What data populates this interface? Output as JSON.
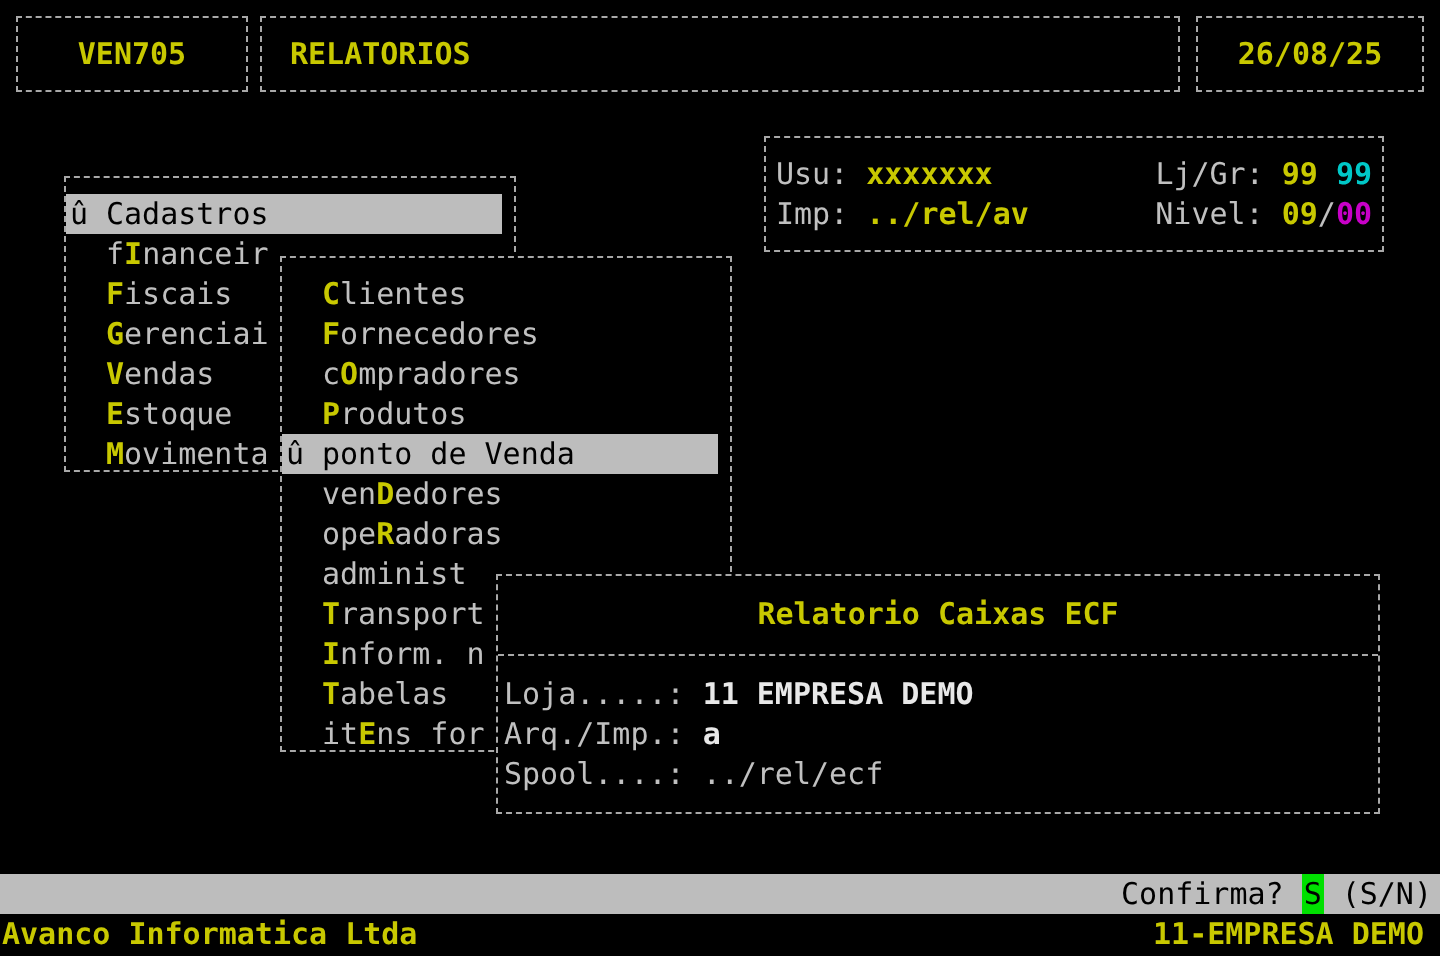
{
  "header": {
    "program": "VEN705",
    "title": "RELATORIOS",
    "date": "26/08/25"
  },
  "session": {
    "user_label": "Usu:",
    "user": "xxxxxxx",
    "printer_label": "Imp:",
    "printer": "../rel/av",
    "store_label": "Lj/Gr:",
    "store": "99",
    "group": "99",
    "level_label": "Nivel:",
    "level_code": "09",
    "level_separator": "/",
    "level_sub": "00"
  },
  "main_menu": {
    "items": [
      {
        "selected": true,
        "marker": "û",
        "segments": [
          {
            "text": "Cadastros",
            "hot": false
          }
        ]
      },
      {
        "selected": false,
        "segments": [
          {
            "text": "f",
            "hot": false
          },
          {
            "text": "I",
            "hot": true
          },
          {
            "text": "nanceir",
            "hot": false
          }
        ]
      },
      {
        "selected": false,
        "segments": [
          {
            "text": "F",
            "hot": true
          },
          {
            "text": "iscais",
            "hot": false
          }
        ]
      },
      {
        "selected": false,
        "segments": [
          {
            "text": "G",
            "hot": true
          },
          {
            "text": "erenciai",
            "hot": false
          }
        ]
      },
      {
        "selected": false,
        "segments": [
          {
            "text": "V",
            "hot": true
          },
          {
            "text": "endas",
            "hot": false
          }
        ]
      },
      {
        "selected": false,
        "segments": [
          {
            "text": "E",
            "hot": true
          },
          {
            "text": "stoque",
            "hot": false
          }
        ]
      },
      {
        "selected": false,
        "segments": [
          {
            "text": "M",
            "hot": true
          },
          {
            "text": "ovimenta",
            "hot": false
          }
        ]
      }
    ]
  },
  "submenu": {
    "items": [
      {
        "selected": false,
        "segments": [
          {
            "text": "C",
            "hot": true
          },
          {
            "text": "lientes",
            "hot": false
          }
        ]
      },
      {
        "selected": false,
        "segments": [
          {
            "text": "F",
            "hot": true
          },
          {
            "text": "ornecedores",
            "hot": false
          }
        ]
      },
      {
        "selected": false,
        "segments": [
          {
            "text": "c",
            "hot": false
          },
          {
            "text": "O",
            "hot": true
          },
          {
            "text": "mpradores",
            "hot": false
          }
        ]
      },
      {
        "selected": false,
        "segments": [
          {
            "text": "P",
            "hot": true
          },
          {
            "text": "rodutos",
            "hot": false
          }
        ]
      },
      {
        "selected": true,
        "marker": "û",
        "segments": [
          {
            "text": "ponto de Venda",
            "hot": false
          }
        ]
      },
      {
        "selected": false,
        "segments": [
          {
            "text": "ven",
            "hot": false
          },
          {
            "text": "D",
            "hot": true
          },
          {
            "text": "edores",
            "hot": false
          }
        ]
      },
      {
        "selected": false,
        "segments": [
          {
            "text": "ope",
            "hot": false
          },
          {
            "text": "R",
            "hot": true
          },
          {
            "text": "adoras",
            "hot": false
          }
        ]
      },
      {
        "selected": false,
        "segments": [
          {
            "text": "administ",
            "hot": false
          }
        ]
      },
      {
        "selected": false,
        "segments": [
          {
            "text": "T",
            "hot": true
          },
          {
            "text": "ransport",
            "hot": false
          }
        ]
      },
      {
        "selected": false,
        "segments": [
          {
            "text": "I",
            "hot": true
          },
          {
            "text": "nform. n",
            "hot": false
          }
        ]
      },
      {
        "selected": false,
        "segments": [
          {
            "text": "T",
            "hot": true
          },
          {
            "text": "abelas",
            "hot": false
          }
        ]
      },
      {
        "selected": false,
        "segments": [
          {
            "text": "it",
            "hot": false
          },
          {
            "text": "E",
            "hot": true
          },
          {
            "text": "ns for",
            "hot": false
          }
        ]
      }
    ]
  },
  "dialog": {
    "title": "Relatorio Caixas ECF",
    "fields": [
      {
        "label": "Loja.....:",
        "value": "11 EMPRESA DEMO",
        "kind": "bold"
      },
      {
        "label": "Arq./Imp.:",
        "value": "a",
        "kind": "bold"
      },
      {
        "label": "Spool....:",
        "value": "../rel/ecf",
        "kind": "plain"
      }
    ]
  },
  "prompt": {
    "label": "Confirma?",
    "value": "S",
    "hint": "(S/N)"
  },
  "footer": {
    "company": "Avanco Informatica Ltda",
    "store": "11-EMPRESA DEMO"
  }
}
